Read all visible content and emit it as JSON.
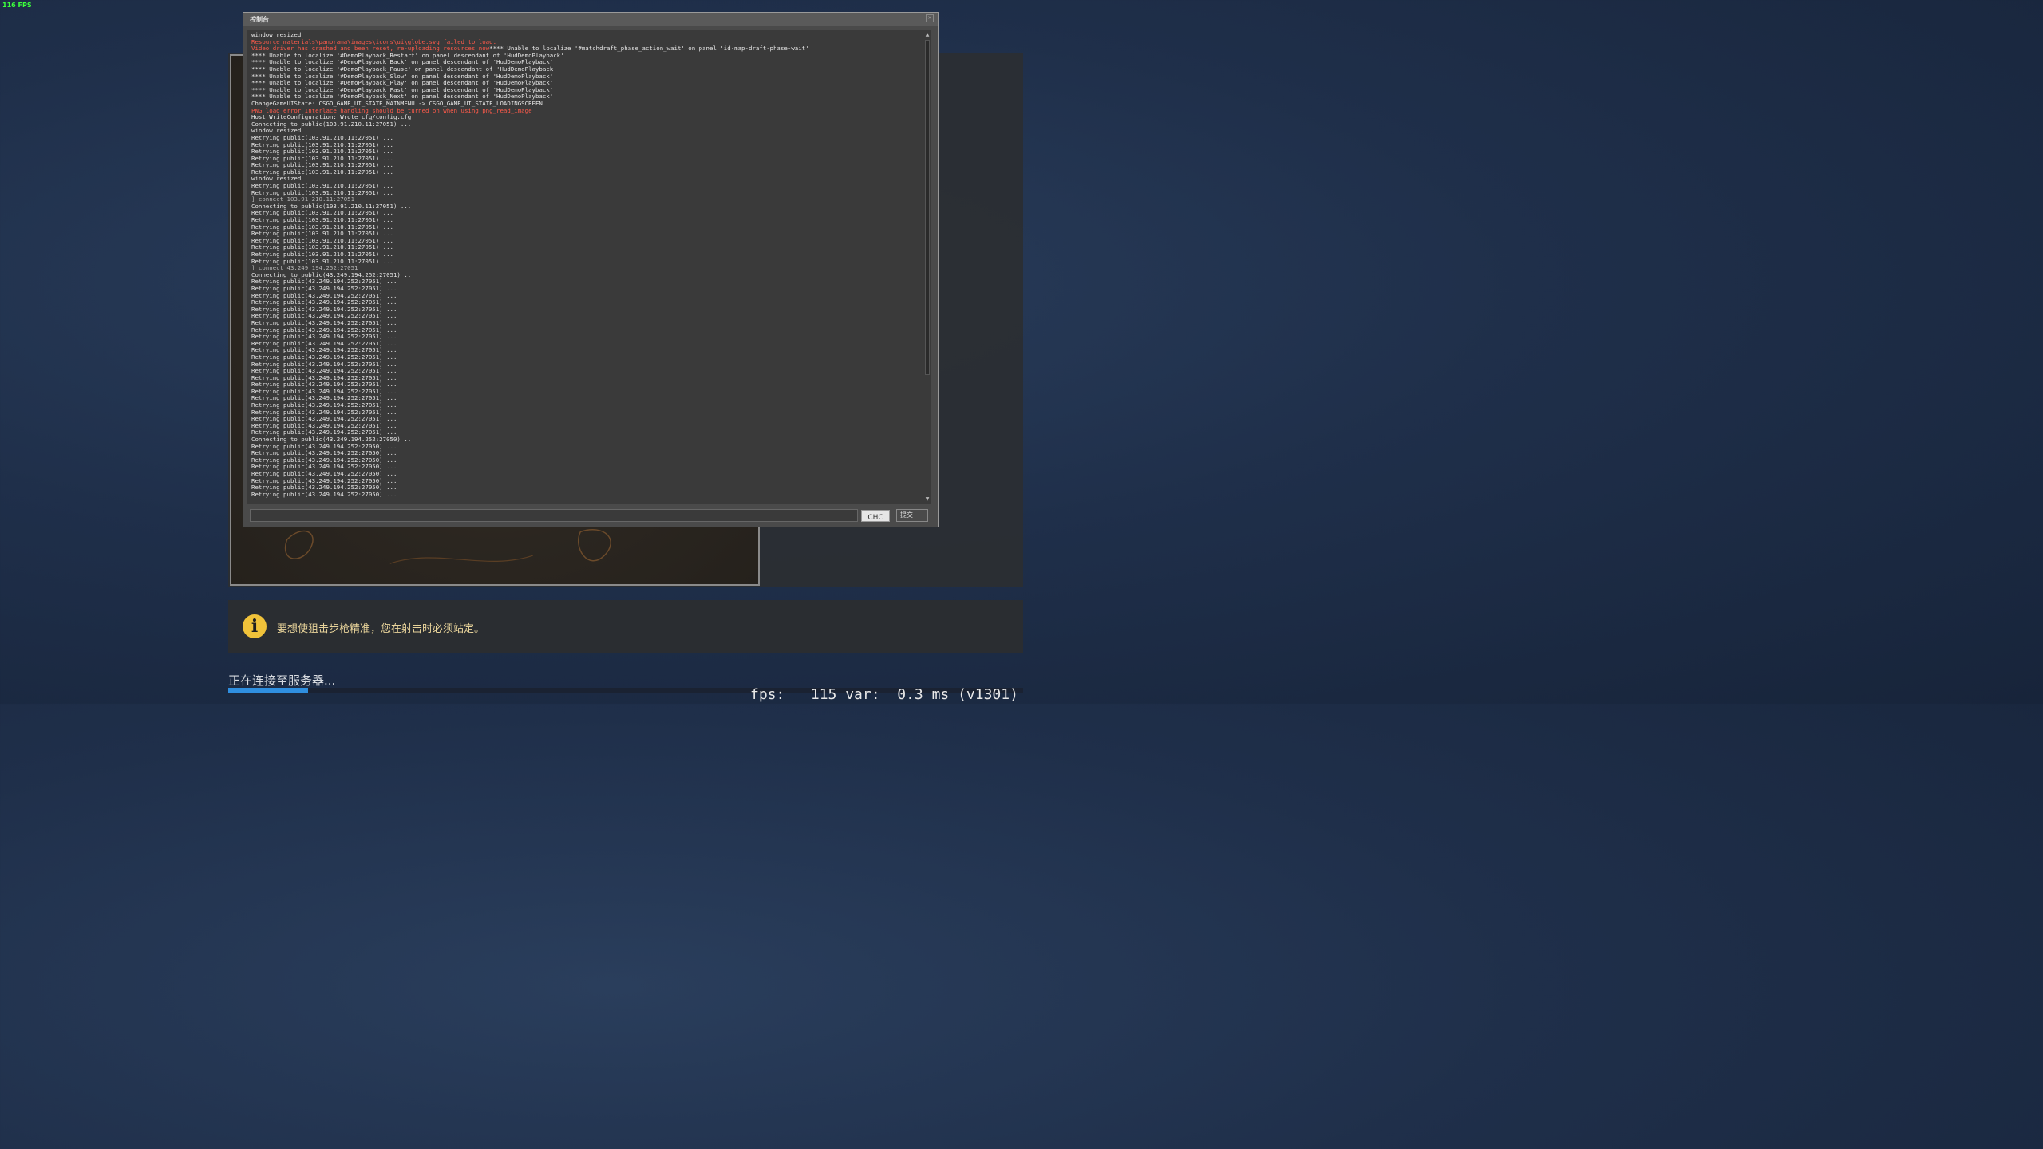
{
  "fps_counter": "116 FPS",
  "console": {
    "title": "控制台",
    "submit_label": "提交",
    "ime_label": "CHC",
    "input_value": "",
    "lines": [
      {
        "t": "window resized",
        "c": ""
      },
      {
        "t": "Resource materials\\panorama\\images\\icons\\ui\\globe.svg failed to load.",
        "c": "err"
      },
      {
        "t": "Video driver has crashed and been reset, re-uploading resources now",
        "c": "err",
        "tail": "**** Unable to localize '#matchdraft_phase_action_wait' on panel 'id-map-draft-phase-wait'"
      },
      {
        "t": "**** Unable to localize '#DemoPlayback_Restart' on panel descendant of 'HudDemoPlayback'",
        "c": ""
      },
      {
        "t": "**** Unable to localize '#DemoPlayback_Back' on panel descendant of 'HudDemoPlayback'",
        "c": ""
      },
      {
        "t": "**** Unable to localize '#DemoPlayback_Pause' on panel descendant of 'HudDemoPlayback'",
        "c": ""
      },
      {
        "t": "**** Unable to localize '#DemoPlayback_Slow' on panel descendant of 'HudDemoPlayback'",
        "c": ""
      },
      {
        "t": "**** Unable to localize '#DemoPlayback_Play' on panel descendant of 'HudDemoPlayback'",
        "c": ""
      },
      {
        "t": "**** Unable to localize '#DemoPlayback_Fast' on panel descendant of 'HudDemoPlayback'",
        "c": ""
      },
      {
        "t": "**** Unable to localize '#DemoPlayback_Next' on panel descendant of 'HudDemoPlayback'",
        "c": ""
      },
      {
        "t": "ChangeGameUIState: CSGO_GAME_UI_STATE_MAINMENU -> CSGO_GAME_UI_STATE_LOADINGSCREEN",
        "c": ""
      },
      {
        "t": "PNG load error Interlace handling should be turned on when using png_read_image",
        "c": "err"
      },
      {
        "t": "Host_WriteConfiguration: Wrote cfg/config.cfg",
        "c": ""
      },
      {
        "t": "Connecting to public(103.91.210.11:27051) ...",
        "c": ""
      },
      {
        "t": "window resized",
        "c": ""
      },
      {
        "t": "Retrying public(103.91.210.11:27051) ...",
        "c": ""
      },
      {
        "t": "Retrying public(103.91.210.11:27051) ...",
        "c": ""
      },
      {
        "t": "Retrying public(103.91.210.11:27051) ...",
        "c": ""
      },
      {
        "t": "Retrying public(103.91.210.11:27051) ...",
        "c": ""
      },
      {
        "t": "Retrying public(103.91.210.11:27051) ...",
        "c": ""
      },
      {
        "t": "Retrying public(103.91.210.11:27051) ...",
        "c": ""
      },
      {
        "t": "window resized",
        "c": ""
      },
      {
        "t": "Retrying public(103.91.210.11:27051) ...",
        "c": ""
      },
      {
        "t": "Retrying public(103.91.210.11:27051) ...",
        "c": ""
      },
      {
        "t": "] connect 103.91.210.11:27051",
        "c": "cmd"
      },
      {
        "t": "Connecting to public(103.91.210.11:27051) ...",
        "c": ""
      },
      {
        "t": "Retrying public(103.91.210.11:27051) ...",
        "c": ""
      },
      {
        "t": "Retrying public(103.91.210.11:27051) ...",
        "c": ""
      },
      {
        "t": "Retrying public(103.91.210.11:27051) ...",
        "c": ""
      },
      {
        "t": "Retrying public(103.91.210.11:27051) ...",
        "c": ""
      },
      {
        "t": "Retrying public(103.91.210.11:27051) ...",
        "c": ""
      },
      {
        "t": "Retrying public(103.91.210.11:27051) ...",
        "c": ""
      },
      {
        "t": "Retrying public(103.91.210.11:27051) ...",
        "c": ""
      },
      {
        "t": "Retrying public(103.91.210.11:27051) ...",
        "c": ""
      },
      {
        "t": "] connect 43.249.194.252:27051",
        "c": "cmd"
      },
      {
        "t": "Connecting to public(43.249.194.252:27051) ...",
        "c": ""
      },
      {
        "t": "Retrying public(43.249.194.252:27051) ...",
        "c": ""
      },
      {
        "t": "Retrying public(43.249.194.252:27051) ...",
        "c": ""
      },
      {
        "t": "Retrying public(43.249.194.252:27051) ...",
        "c": ""
      },
      {
        "t": "Retrying public(43.249.194.252:27051) ...",
        "c": ""
      },
      {
        "t": "Retrying public(43.249.194.252:27051) ...",
        "c": ""
      },
      {
        "t": "Retrying public(43.249.194.252:27051) ...",
        "c": ""
      },
      {
        "t": "Retrying public(43.249.194.252:27051) ...",
        "c": ""
      },
      {
        "t": "Retrying public(43.249.194.252:27051) ...",
        "c": ""
      },
      {
        "t": "Retrying public(43.249.194.252:27051) ...",
        "c": ""
      },
      {
        "t": "Retrying public(43.249.194.252:27051) ...",
        "c": ""
      },
      {
        "t": "Retrying public(43.249.194.252:27051) ...",
        "c": ""
      },
      {
        "t": "Retrying public(43.249.194.252:27051) ...",
        "c": ""
      },
      {
        "t": "Retrying public(43.249.194.252:27051) ...",
        "c": ""
      },
      {
        "t": "Retrying public(43.249.194.252:27051) ...",
        "c": ""
      },
      {
        "t": "Retrying public(43.249.194.252:27051) ...",
        "c": ""
      },
      {
        "t": "Retrying public(43.249.194.252:27051) ...",
        "c": ""
      },
      {
        "t": "Retrying public(43.249.194.252:27051) ...",
        "c": ""
      },
      {
        "t": "Retrying public(43.249.194.252:27051) ...",
        "c": ""
      },
      {
        "t": "Retrying public(43.249.194.252:27051) ...",
        "c": ""
      },
      {
        "t": "Retrying public(43.249.194.252:27051) ...",
        "c": ""
      },
      {
        "t": "Retrying public(43.249.194.252:27051) ...",
        "c": ""
      },
      {
        "t": "Retrying public(43.249.194.252:27051) ...",
        "c": ""
      },
      {
        "t": "Retrying public(43.249.194.252:27051) ...",
        "c": ""
      },
      {
        "t": "Connecting to public(43.249.194.252:27050) ...",
        "c": ""
      },
      {
        "t": "Retrying public(43.249.194.252:27050) ...",
        "c": ""
      },
      {
        "t": "Retrying public(43.249.194.252:27050) ...",
        "c": ""
      },
      {
        "t": "Retrying public(43.249.194.252:27050) ...",
        "c": ""
      },
      {
        "t": "Retrying public(43.249.194.252:27050) ...",
        "c": ""
      },
      {
        "t": "Retrying public(43.249.194.252:27050) ...",
        "c": ""
      },
      {
        "t": "Retrying public(43.249.194.252:27050) ...",
        "c": ""
      },
      {
        "t": "Retrying public(43.249.194.252:27050) ...",
        "c": ""
      },
      {
        "t": "Retrying public(43.249.194.252:27050) ...",
        "c": ""
      }
    ]
  },
  "loading": {
    "tip_icon": "info-icon",
    "tip_text": "要想使狙击步枪精准，您在射击时必须站定。",
    "status_text": "正在连接至服务器...",
    "progress_fraction": 0.1,
    "perf_readout": "fps:   115 var:  0.3 ms (v1301)"
  },
  "colors": {
    "error_text": "#ff5a4a",
    "fps_counter": "#3cff3c",
    "tip_icon": "#f0c23a",
    "progress": "#2f8fe0"
  }
}
